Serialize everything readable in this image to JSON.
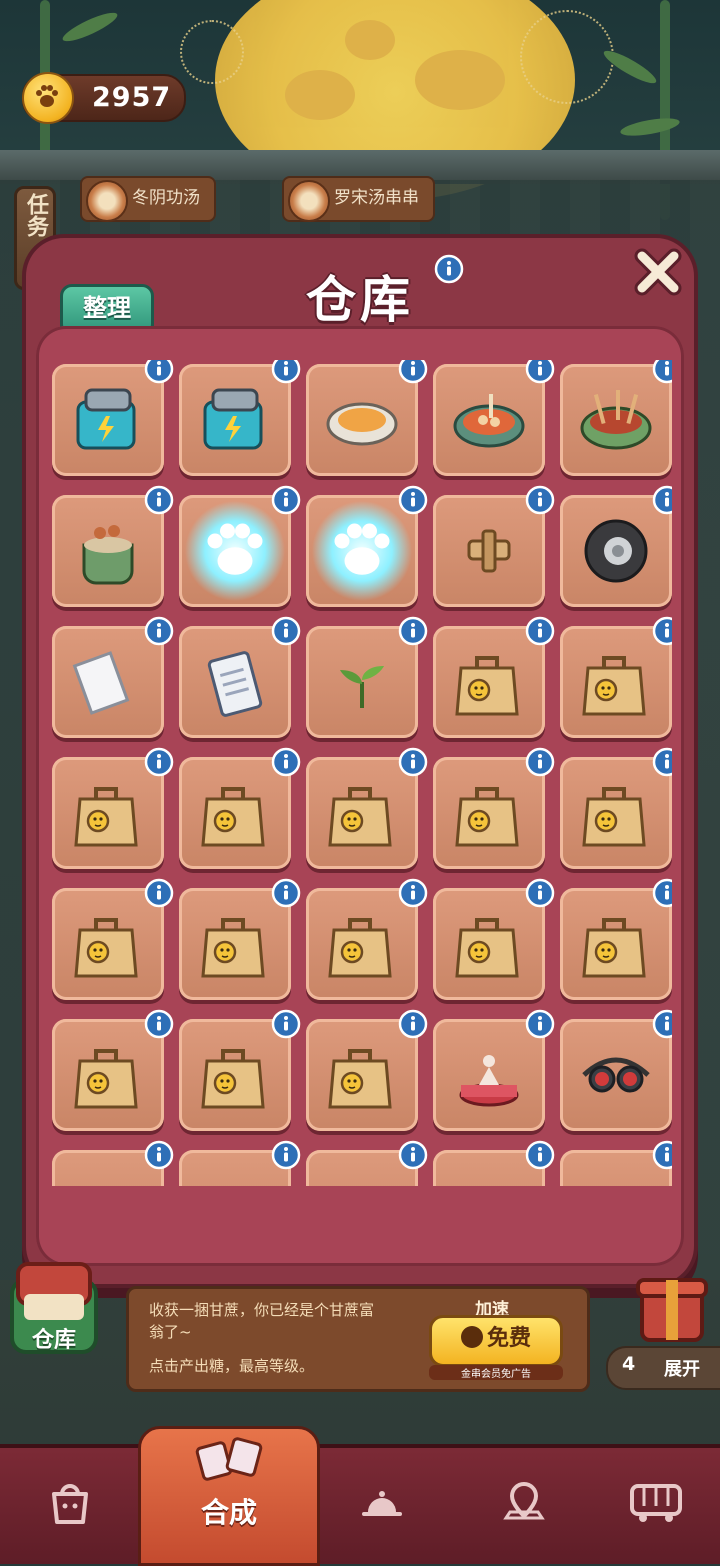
{
  "hud": {
    "coins": "2957",
    "task_tab": "任务"
  },
  "orders": [
    {
      "name": "冬阴功汤"
    },
    {
      "name": "罗宋汤串串"
    }
  ],
  "modal": {
    "title": "仓库",
    "sort_button": "整理"
  },
  "inventory": {
    "items": [
      {
        "name": "battery-machine-icon",
        "kind": "machine"
      },
      {
        "name": "battery-machine-icon",
        "kind": "machine"
      },
      {
        "name": "soup-bowl-icon",
        "kind": "bowl"
      },
      {
        "name": "meatball-soup-icon",
        "kind": "soup"
      },
      {
        "name": "skewer-pot-icon",
        "kind": "pot"
      },
      {
        "name": "skewer-jar-icon",
        "kind": "jar"
      },
      {
        "name": "glowing-paw-machine-icon",
        "kind": "glow"
      },
      {
        "name": "glowing-paw-frame-icon",
        "kind": "glow"
      },
      {
        "name": "wood-clamp-icon",
        "kind": "clamp"
      },
      {
        "name": "tire-icon",
        "kind": "tire"
      },
      {
        "name": "paper-sheet-icon",
        "kind": "paper"
      },
      {
        "name": "notepad-icon",
        "kind": "notepad"
      },
      {
        "name": "seedling-icon",
        "kind": "sprout"
      },
      {
        "name": "paper-bag-icon",
        "kind": "bag"
      },
      {
        "name": "paper-bag-icon",
        "kind": "bag"
      },
      {
        "name": "paper-bag-icon",
        "kind": "bag"
      },
      {
        "name": "paper-bag-icon",
        "kind": "bag"
      },
      {
        "name": "paper-bag-icon",
        "kind": "bag"
      },
      {
        "name": "paper-bag-icon",
        "kind": "bag"
      },
      {
        "name": "paper-bag-icon",
        "kind": "bag"
      },
      {
        "name": "paper-bag-icon",
        "kind": "bag"
      },
      {
        "name": "paper-bag-icon",
        "kind": "bag"
      },
      {
        "name": "paper-bag-icon",
        "kind": "bag"
      },
      {
        "name": "paper-bag-icon",
        "kind": "bag"
      },
      {
        "name": "paper-bag-icon",
        "kind": "bag"
      },
      {
        "name": "paper-bag-icon",
        "kind": "bag"
      },
      {
        "name": "paper-bag-icon",
        "kind": "bag"
      },
      {
        "name": "paper-bag-icon",
        "kind": "bag"
      },
      {
        "name": "ballerina-music-box-icon",
        "kind": "musicbox"
      },
      {
        "name": "goggles-icon",
        "kind": "goggles"
      },
      {
        "name": "sushi-icon",
        "kind": "partial"
      },
      {
        "name": "blue-orb-icon",
        "kind": "partial"
      },
      {
        "name": "blue-flower-icon",
        "kind": "partial"
      },
      {
        "name": "orange-bow-icon",
        "kind": "partial"
      },
      {
        "name": "paper-fan-icon",
        "kind": "partial"
      }
    ]
  },
  "bottom_panel": {
    "warehouse_label": "仓库",
    "message_line1": "收获一捆甘蔗，你已经是个甘蔗富",
    "message_line2": "翁了~",
    "message_line3": "点击产出糖，最高等级。",
    "speed_label": "加速",
    "free_button": "免费",
    "free_sub": "金串会员免广告",
    "expand_count": "4",
    "expand_label": "展开"
  },
  "nav": {
    "active_label": "合成",
    "items": [
      "shop-bag-icon",
      "merge-icon",
      "service-bell-icon",
      "map-pin-icon",
      "bus-icon"
    ]
  },
  "colors": {
    "modal": "#8c3745",
    "slot": "#d8967a",
    "info_badge": "#2e6fb7",
    "sort_button": "#3aa98a",
    "nav_active": "#d65c3a"
  }
}
